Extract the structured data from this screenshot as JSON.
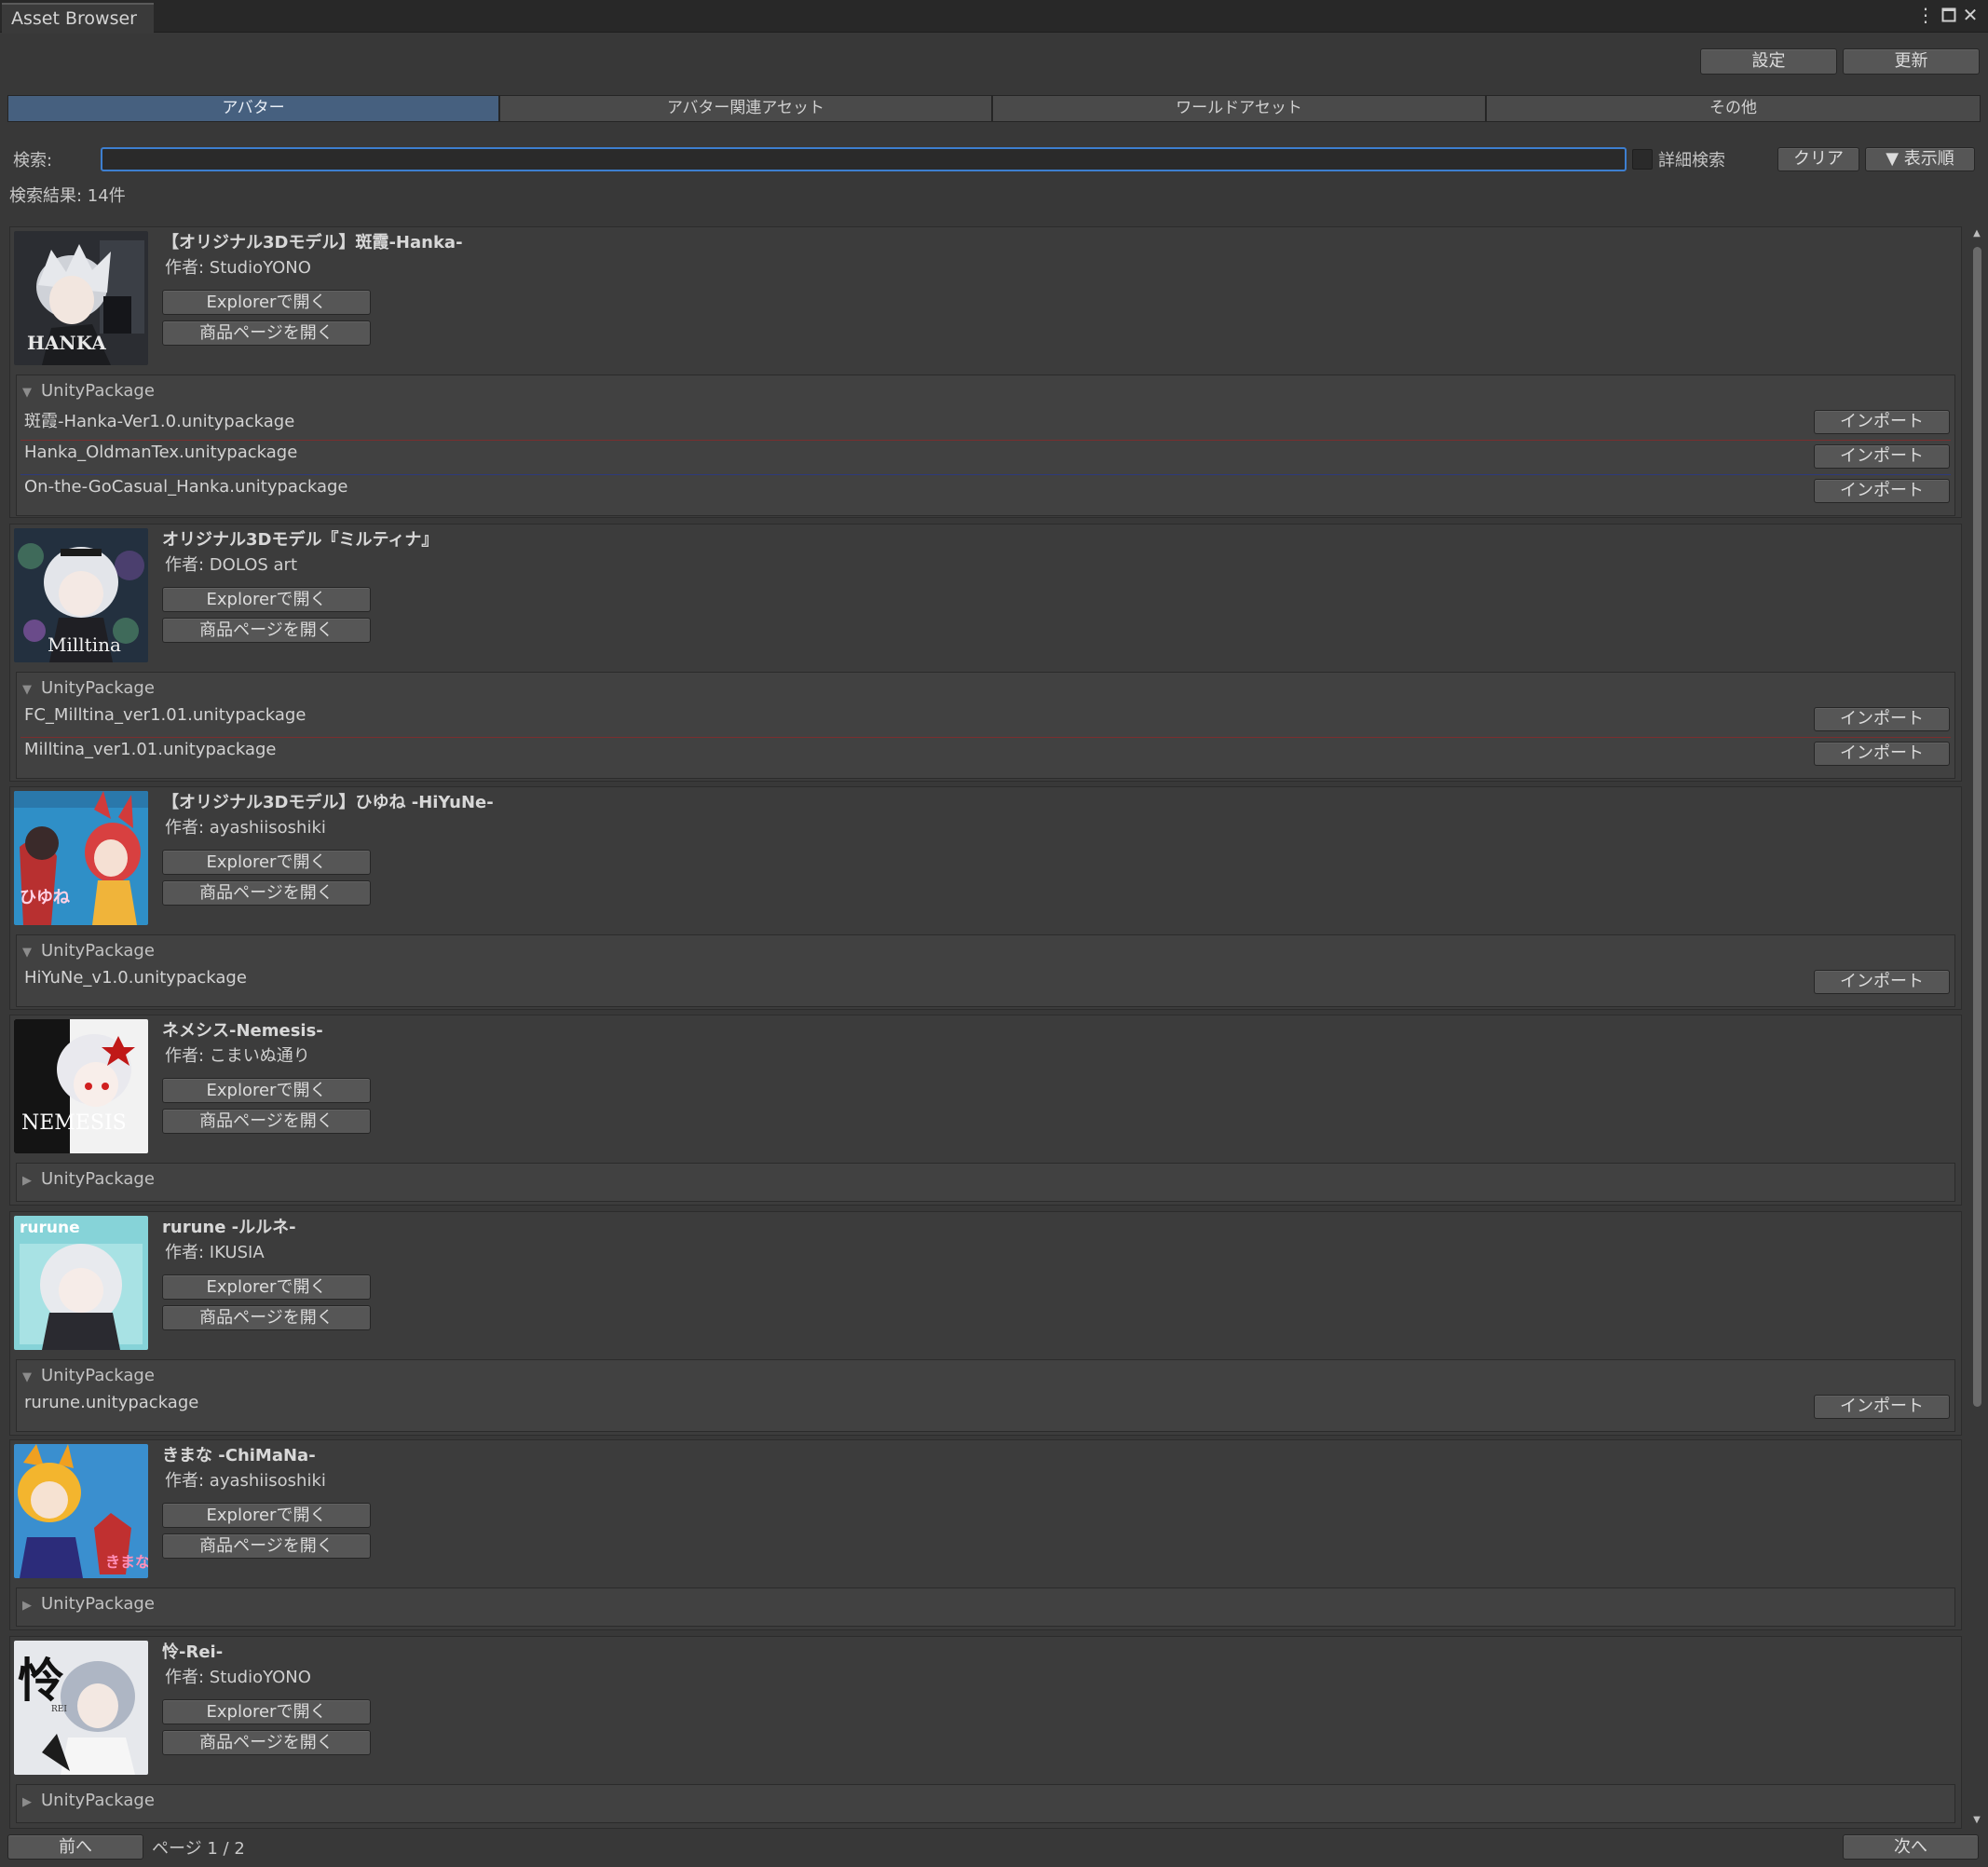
{
  "window": {
    "title": "Asset Browser"
  },
  "toolbar": {
    "settings_label": "設定",
    "refresh_label": "更新"
  },
  "tabs": [
    {
      "label": "アバター",
      "active": true
    },
    {
      "label": "アバター関連アセット",
      "active": false
    },
    {
      "label": "ワールドアセット",
      "active": false
    },
    {
      "label": "その他",
      "active": false
    }
  ],
  "search": {
    "label": "検索:",
    "value": "",
    "placeholder": "",
    "advanced_label": "詳細検索",
    "advanced_checked": false,
    "clear_label": "クリア",
    "sort_label": "▼ 表示順"
  },
  "result_count": "検索結果: 14件",
  "common": {
    "explorer_label": "Explorerで開く",
    "store_label": "商品ページを開く",
    "import_label": "インポート",
    "package_section_label": "UnityPackage"
  },
  "items": [
    {
      "title": "【オリジナル3Dモデル】斑霞-Hanka-",
      "author": "作者: StudioYONO",
      "expanded": true,
      "packages": [
        "斑霞-Hanka-Ver1.0.unitypackage",
        "Hanka_OldmanTex.unitypackage",
        "On-the-GoCasual_Hanka.unitypackage"
      ]
    },
    {
      "title": "オリジナル3Dモデル『ミルティナ』",
      "author": "作者: DOLOS art",
      "expanded": true,
      "packages": [
        "FC_Milltina_ver1.01.unitypackage",
        "Milltina_ver1.01.unitypackage"
      ]
    },
    {
      "title": "【オリジナル3Dモデル】ひゆね -HiYuNe-",
      "author": "作者: ayashiisoshiki",
      "expanded": true,
      "packages": [
        "HiYuNe_v1.0.unitypackage"
      ]
    },
    {
      "title": "ネメシス-Nemesis-",
      "author": "作者: こまいぬ通り",
      "expanded": false,
      "packages": []
    },
    {
      "title": "rurune -ルルネ-",
      "author": "作者: IKUSIA",
      "expanded": true,
      "packages": [
        "rurune.unitypackage"
      ]
    },
    {
      "title": "きまな -ChiMaNa-",
      "author": "作者: ayashiisoshiki",
      "expanded": false,
      "packages": []
    },
    {
      "title": "怜-Rei-",
      "author": "作者: StudioYONO",
      "expanded": false,
      "packages": []
    }
  ],
  "thumb_text": {
    "hanka": "HANKA",
    "milltina": "Milltina",
    "hiyune": "ひゆね",
    "nemesis": "NEMESIS",
    "rurune": "rurune",
    "chimana": "きまな",
    "rei_kanji": "怜",
    "rei_latin": "REI"
  },
  "pagination": {
    "prev_label": "前へ",
    "page_info": "ページ 1 / 2",
    "next_label": "次へ"
  },
  "colors": {
    "accent_tab": "#46607f",
    "search_focus": "#3d7fd0"
  }
}
